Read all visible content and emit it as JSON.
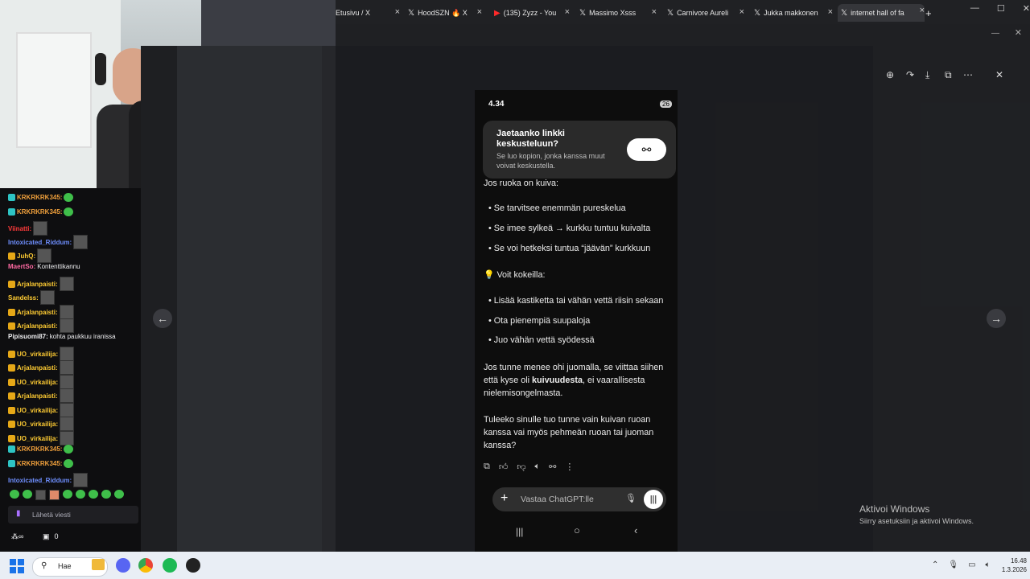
{
  "browser": {
    "tabs": [
      {
        "label": "Etusivu / X",
        "icon": "x-logo-icon"
      },
      {
        "label": "HoodSZN 🔥 X",
        "icon": "x-logo-icon"
      },
      {
        "label": "(135) Zyzz - You",
        "icon": "youtube-icon"
      },
      {
        "label": "Massimo Xsss",
        "icon": "x-logo-icon"
      },
      {
        "label": "Carnivore Aureli",
        "icon": "x-logo-icon"
      },
      {
        "label": "Jukka makkonen",
        "icon": "x-logo-icon"
      },
      {
        "label": "internet hall of fa",
        "icon": "x-logo-icon",
        "active": true
      }
    ],
    "new_tab": "+"
  },
  "chat": {
    "messages": [
      {
        "user": "KRKRKRK345:",
        "color": "#f0a03c",
        "badge_color": "#2ec4c4",
        "emote": "green"
      },
      {
        "user": "KRKRKRK345:",
        "color": "#f0a03c",
        "badge_color": "#2ec4c4",
        "emote": "green"
      },
      {
        "user": "Viinatti:",
        "color": "#ff3a3a",
        "emote": "img"
      },
      {
        "user": "Intoxicated_Riddum:",
        "color": "#6f8fff",
        "emote": "img"
      },
      {
        "user": "JuhQ:",
        "color": "#ffcc33",
        "badge_color": "#e6a817",
        "emote": "img"
      },
      {
        "user": "MaertSo:",
        "color": "#ff6aa2",
        "message": "Kontenttikannu"
      },
      {
        "user": "Arjalanpaisti:",
        "color": "#ffcc33",
        "badge_color": "#e6a817",
        "emote": "img"
      },
      {
        "user": "Sandelss:",
        "color": "#ffcc33",
        "emote": "img"
      },
      {
        "user": "Arjalanpaisti:",
        "color": "#ffcc33",
        "badge_color": "#e6a817",
        "emote": "img"
      },
      {
        "user": "Arjalanpaisti:",
        "color": "#ffcc33",
        "badge_color": "#e6a817",
        "emote": "img"
      },
      {
        "user": "Pipisuomi87:",
        "color": "#efeff1",
        "message": "kohta paukkuu iranissa"
      },
      {
        "user": "UO_virkailija:",
        "color": "#ffcc33",
        "badge_color": "#e6a817",
        "emote": "img"
      },
      {
        "user": "Arjalanpaisti:",
        "color": "#ffcc33",
        "badge_color": "#e6a817",
        "emote": "img"
      },
      {
        "user": "UO_virkailija:",
        "color": "#ffcc33",
        "badge_color": "#e6a817",
        "emote": "img"
      },
      {
        "user": "Arjalanpaisti:",
        "color": "#ffcc33",
        "badge_color": "#e6a817",
        "emote": "img"
      },
      {
        "user": "UO_virkailija:",
        "color": "#ffcc33",
        "badge_color": "#e6a817",
        "emote": "img"
      },
      {
        "user": "UO_virkailija:",
        "color": "#ffcc33",
        "badge_color": "#e6a817",
        "emote": "img"
      },
      {
        "user": "UO_virkailija:",
        "color": "#ffcc33",
        "badge_color": "#e6a817",
        "emote": "img"
      },
      {
        "user": "KRKRKRK345:",
        "color": "#f0a03c",
        "badge_color": "#2ec4c4",
        "emote": "green"
      },
      {
        "user": "KRKRKRK345:",
        "color": "#f0a03c",
        "badge_color": "#2ec4c4",
        "emote": "green"
      },
      {
        "user": "Intoxicated_Riddum:",
        "color": "#6f8fff",
        "emote": "img"
      }
    ],
    "input_placeholder": "Lähetä viesti",
    "points": "0"
  },
  "viewer": {
    "phone": {
      "time": "4.34",
      "battery": "26",
      "share_card": {
        "title": "Jaetaanko linkki keskusteluun?",
        "subtitle": "Se luo kopion, jonka kanssa muut voivat keskustella."
      },
      "dry_food_heading": "Jos ruoka on kuiva:",
      "dry_food_bullets": [
        "Se tarvitsee enemmän pureskelua",
        "Se imee sylkeä → kurkku tuntuu kuivalta",
        "Se voi hetkeksi tuntua “jäävän” kurkkuun"
      ],
      "tips_heading": "💡 Voit kokeilla:",
      "tips_bullets": [
        "Lisää kastiketta tai vähän vettä riisin sekaan",
        "Ota pienempiä suupaloja",
        "Juo vähän vettä syödessä"
      ],
      "para1_a": "Jos tunne menee ohi juomalla, se viittaa siihen että kyse oli ",
      "para1_bold": "kuivuudesta",
      "para1_b": ", ei vaarallisesta nielemisongelmasta.",
      "para2": "Tuleeko sinulle tuo tunne vain kuivan ruoan kanssa vai myös pehmeän ruoan tai juoman kanssa?",
      "input_placeholder": "Vastaa ChatGPT:lle"
    }
  },
  "watermark": {
    "title": "Aktivoi Windows",
    "subtitle": "Siirry asetuksiin ja aktivoi Windows."
  },
  "taskbar": {
    "search_label": "Hae",
    "time": "16.48",
    "date": "1.3.2026"
  }
}
